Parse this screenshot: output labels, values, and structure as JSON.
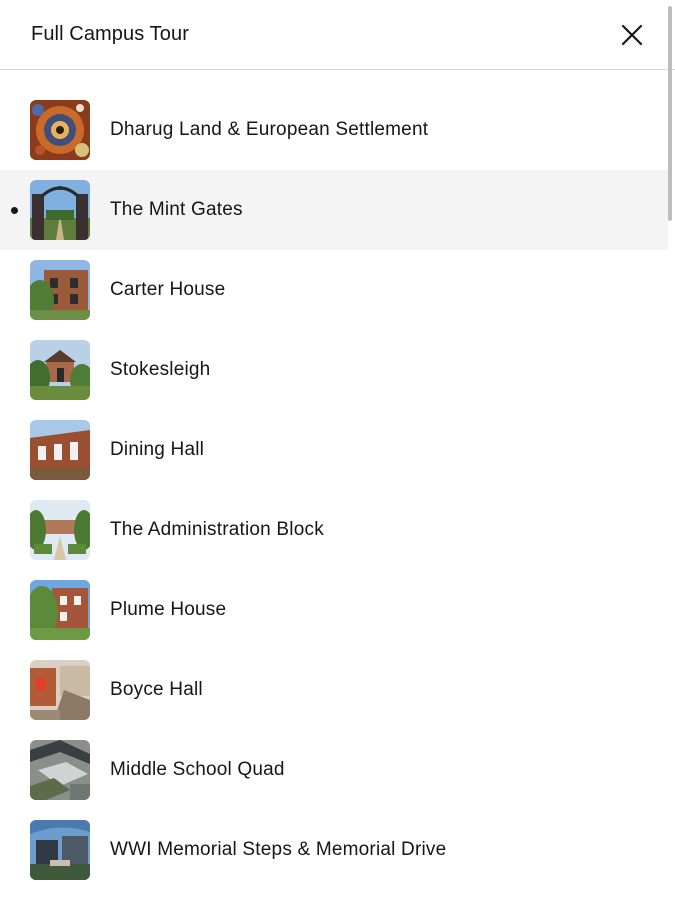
{
  "header": {
    "title": "Full Campus Tour",
    "close_icon": "close-icon"
  },
  "stops": [
    {
      "label": "Dharug Land & European Settlement",
      "thumb": "aboriginal-art",
      "active": false
    },
    {
      "label": "The Mint Gates",
      "thumb": "gates",
      "active": true
    },
    {
      "label": "Carter House",
      "thumb": "brick-house",
      "active": false
    },
    {
      "label": "Stokesleigh",
      "thumb": "cottage",
      "active": false
    },
    {
      "label": "Dining Hall",
      "thumb": "brick-hall",
      "active": false
    },
    {
      "label": "The Administration Block",
      "thumb": "garden-path",
      "active": false
    },
    {
      "label": "Plume House",
      "thumb": "brick-house-trees",
      "active": false
    },
    {
      "label": "Boyce Hall",
      "thumb": "courtyard",
      "active": false
    },
    {
      "label": "Middle School Quad",
      "thumb": "aerial-quad",
      "active": false
    },
    {
      "label": "WWI Memorial Steps & Memorial Drive",
      "thumb": "memorial",
      "active": false
    }
  ],
  "colors": {
    "active_background": "#f4f4f4",
    "divider": "#d7d7d7",
    "text": "#161616"
  }
}
